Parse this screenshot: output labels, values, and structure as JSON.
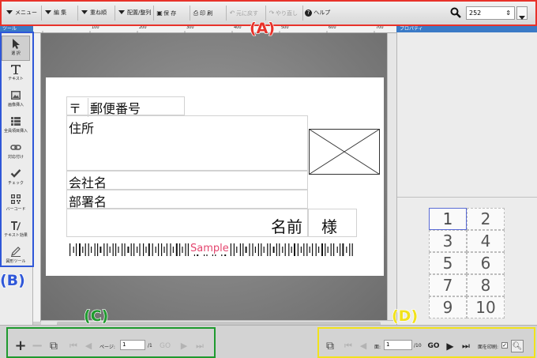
{
  "toolbar": {
    "menu": "メニュー",
    "edit": "編 集",
    "layer": "重ね順",
    "arrange": "配置/整列",
    "save": "保 存",
    "print": "印 刷",
    "undo": "元に戻す",
    "redo": "やり直し",
    "help": "ヘルプ",
    "zoom_value": "252"
  },
  "tools": {
    "header": "ツール",
    "items": [
      "選 択",
      "テキスト",
      "画像挿入",
      "全員項目挿入",
      "対応付け",
      "チェック",
      "バーコード",
      "テキスト効果",
      "図形ツール"
    ]
  },
  "ruler": {
    "ticks": [
      "100",
      "200",
      "300",
      "400",
      "500",
      "600",
      "700",
      "800"
    ]
  },
  "card": {
    "postal_mark": "〒",
    "postal_label": "郵便番号",
    "address": "住所",
    "company": "会社名",
    "department": "部署名",
    "name": "名前",
    "honorific": "様",
    "barcode_text": "Sample"
  },
  "properties": {
    "header": "プロパティ",
    "pages": [
      "1",
      "2",
      "3",
      "4",
      "5",
      "6",
      "7",
      "8",
      "9",
      "10"
    ]
  },
  "bottom_left": {
    "page_label": "ページ:",
    "page_value": "1",
    "page_total": "/1",
    "go": "GO"
  },
  "bottom_right": {
    "face_label": "面:",
    "face_value": "1",
    "face_total": "/10",
    "go": "GO",
    "print_face_label": "面を印刷:"
  },
  "annotations": {
    "a": "(A)",
    "b": "(B)",
    "c": "(C)",
    "d": "(D)",
    "colors": {
      "a": "#e8322a",
      "b": "#2f57d8",
      "c": "#1e9a2e",
      "d": "#f1e21c"
    }
  }
}
